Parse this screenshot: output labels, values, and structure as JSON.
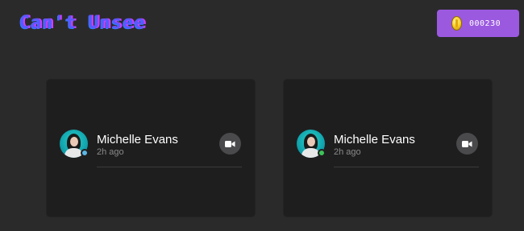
{
  "header": {
    "logo_text": "Can't Unsee",
    "coin_icon": "coin-icon",
    "coin_balance": "000230"
  },
  "cards": [
    {
      "name": "Michelle Evans",
      "time": "2h ago",
      "status_color": "#5ab7e6",
      "action_icon": "video-camera-icon"
    },
    {
      "name": "Michelle Evans",
      "time": "2h ago",
      "status_color": "#3cc45a",
      "action_icon": "video-camera-icon"
    }
  ],
  "colors": {
    "background": "#2b2a2b",
    "card": "#1f1e1f",
    "coin_badge": "#9b59e0",
    "logo": "#5a58ff"
  }
}
